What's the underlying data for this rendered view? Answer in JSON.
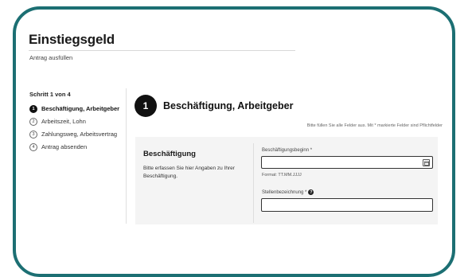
{
  "app": {
    "title": "Einstiegsgeld",
    "subtitle": "Antrag ausfüllen"
  },
  "steps": {
    "header": "Schritt 1 von 4",
    "items": [
      {
        "num": "1",
        "label": "Beschäftigung, Arbeitgeber",
        "active": true
      },
      {
        "num": "2",
        "label": "Arbeitszeit, Lohn",
        "active": false
      },
      {
        "num": "3",
        "label": "Zahlungsweg, Arbeitsvertrag",
        "active": false
      },
      {
        "num": "4",
        "label": "Antrag absenden",
        "active": false
      }
    ]
  },
  "section": {
    "number": "1",
    "title": "Beschäftigung, Arbeitgeber",
    "hint": "Bitte füllen Sie alle Felder aus. Mit * markierte Felder sind Pflichtfelder"
  },
  "card": {
    "title": "Beschäftigung",
    "description": "Bitte erfassen Sie hier Angaben zu Ihrer Beschäftigung."
  },
  "fields": {
    "start_label": "Beschäftigungsbeginn *",
    "start_value": "",
    "start_format": "Format: TT.MM.JJJJ",
    "job_label": "Stellenbezeichnung *",
    "job_value": ""
  },
  "icons": {
    "calendar": "calendar-icon",
    "info": "info-icon"
  },
  "colors": {
    "frame": "#1c6f73",
    "accent": "#111111"
  }
}
